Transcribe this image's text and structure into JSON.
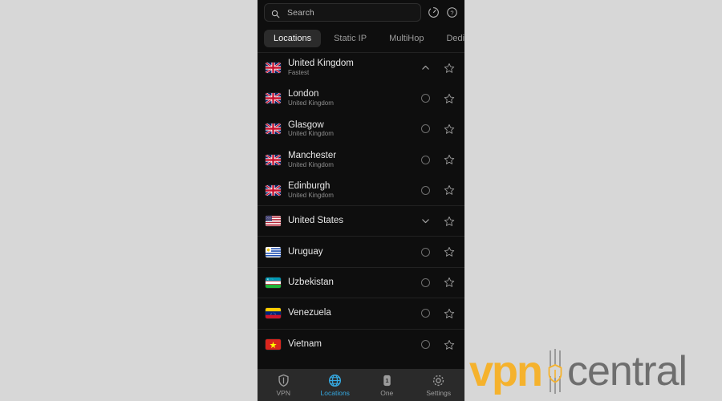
{
  "search": {
    "placeholder": "Search",
    "value": "",
    "icon": "search-icon"
  },
  "header_icons": [
    {
      "name": "speed-test-icon",
      "glyph": "gauge"
    },
    {
      "name": "help-icon",
      "glyph": "question-circle"
    }
  ],
  "tabs": [
    {
      "label": "Locations",
      "active": true
    },
    {
      "label": "Static IP",
      "active": false
    },
    {
      "label": "MultiHop",
      "active": false
    },
    {
      "label": "Dedi",
      "active": false
    }
  ],
  "list": [
    {
      "name": "United Kingdom",
      "sub": "Fastest",
      "flag": "gb",
      "action": "chevron-up",
      "starred": false,
      "divider_top": true,
      "divider_bottom": false
    },
    {
      "name": "London",
      "sub": "United Kingdom",
      "flag": "gb",
      "action": "circle",
      "starred": false,
      "divider_top": false,
      "divider_bottom": false
    },
    {
      "name": "Glasgow",
      "sub": "United Kingdom",
      "flag": "gb",
      "action": "circle",
      "starred": false,
      "divider_top": false,
      "divider_bottom": false
    },
    {
      "name": "Manchester",
      "sub": "United Kingdom",
      "flag": "gb",
      "action": "circle",
      "starred": false,
      "divider_top": false,
      "divider_bottom": false
    },
    {
      "name": "Edinburgh",
      "sub": "United Kingdom",
      "flag": "gb",
      "action": "circle",
      "starred": false,
      "divider_top": false,
      "divider_bottom": true
    },
    {
      "name": "United States",
      "sub": "",
      "flag": "us",
      "action": "chevron-down",
      "starred": false,
      "divider_top": false,
      "divider_bottom": true
    },
    {
      "name": "Uruguay",
      "sub": "",
      "flag": "uy",
      "action": "circle",
      "starred": false,
      "divider_top": false,
      "divider_bottom": true
    },
    {
      "name": "Uzbekistan",
      "sub": "",
      "flag": "uz",
      "action": "circle",
      "starred": false,
      "divider_top": false,
      "divider_bottom": true
    },
    {
      "name": "Venezuela",
      "sub": "",
      "flag": "ve",
      "action": "circle",
      "starred": false,
      "divider_top": false,
      "divider_bottom": true
    },
    {
      "name": "Vietnam",
      "sub": "",
      "flag": "vn",
      "action": "circle",
      "starred": false,
      "divider_top": false,
      "divider_bottom": false
    }
  ],
  "nav": [
    {
      "label": "VPN",
      "icon": "shield-icon",
      "active": false
    },
    {
      "label": "Locations",
      "icon": "globe-icon",
      "active": true
    },
    {
      "label": "One",
      "icon": "one-badge-icon",
      "active": false
    },
    {
      "label": "Settings",
      "icon": "gear-icon",
      "active": false
    }
  ],
  "watermark": {
    "brand": "vpn",
    "suffix": "central",
    "brand_color": "#f5b22d",
    "suffix_color": "#6e6e6e"
  },
  "colors": {
    "panel_bg": "#0e0e0e",
    "page_bg": "#d7d7d7",
    "accent": "#35a8e0",
    "nav_bg": "#2a2a2a"
  }
}
